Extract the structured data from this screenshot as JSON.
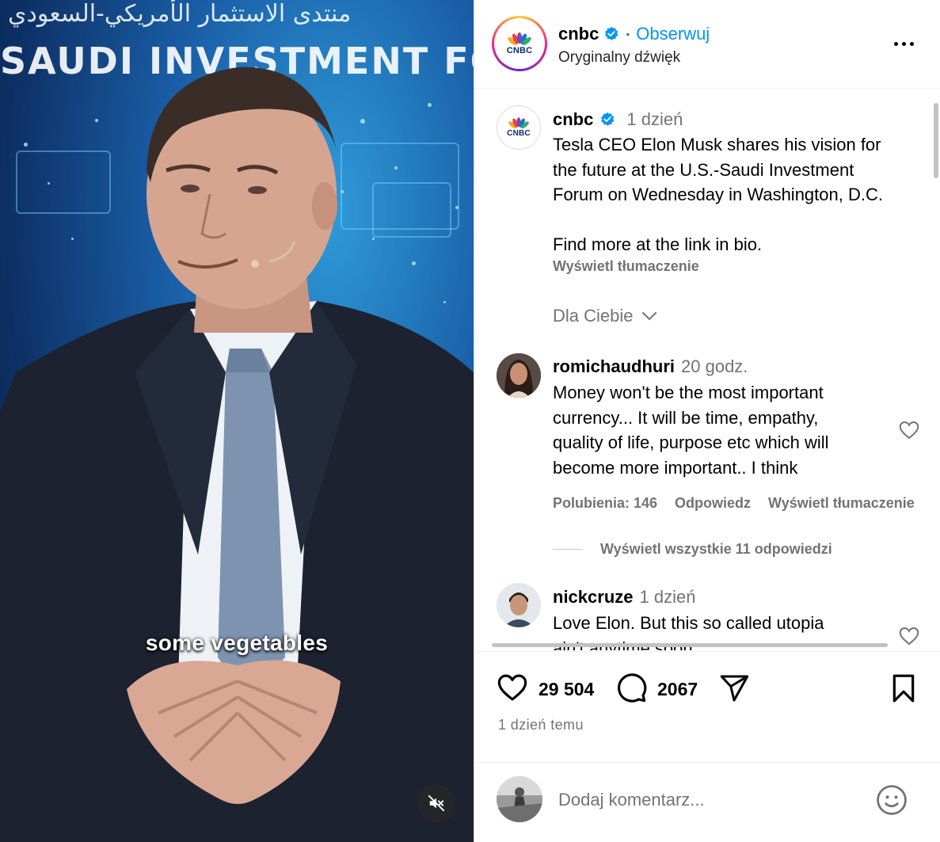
{
  "video": {
    "banner_arabic": "منتدى الاستثمار الأمريكي-السعودي",
    "banner_text": "SAUDI INVESTMENT FORUM",
    "caption": "some vegetables",
    "mute_icon": "speaker-muted-icon"
  },
  "header": {
    "logo_word": "CNBC",
    "username": "cnbc",
    "verified": true,
    "separator": "•",
    "follow_label": "Obserwuj",
    "audio_label": "Oryginalny dźwięk"
  },
  "caption_post": {
    "username": "cnbc",
    "time": "1 dzień",
    "text_line1": "Tesla CEO Elon Musk shares his vision for",
    "text_line2": "the future at the U.S.-Saudi Investment",
    "text_line3": "Forum on Wednesday in Washington, D.C.",
    "text_line4": "Find more at the link in bio.",
    "translate_label": "Wyświetl tłumaczenie"
  },
  "filter": {
    "label": "Dla Ciebie"
  },
  "comments": [
    {
      "username": "romichaudhuri",
      "time": "20 godz.",
      "lines": [
        "Money won't be the most important",
        "currency... It will be time, empathy,",
        "quality of life, purpose etc which will",
        "become more important.. I think"
      ],
      "likes_label": "Polubienia: 146",
      "reply_label": "Odpowiedz",
      "translate_label": "Wyświetl tłumaczenie",
      "view_replies_label": "Wyświetl wszystkie 11 odpowiedzi"
    },
    {
      "username": "nickcruze",
      "time": "1 dzień",
      "lines": [
        "Love Elon. But this so called utopia",
        "ain't anytime soon"
      ]
    }
  ],
  "actions": {
    "likes_count": "29 504",
    "comments_count": "2067",
    "date_label": "1 dzień temu"
  },
  "add_comment": {
    "placeholder": "Dodaj komentarz..."
  },
  "colors": {
    "link_blue": "#0095f6",
    "verified_blue": "#0095f6",
    "secondary_text": "#737373"
  }
}
